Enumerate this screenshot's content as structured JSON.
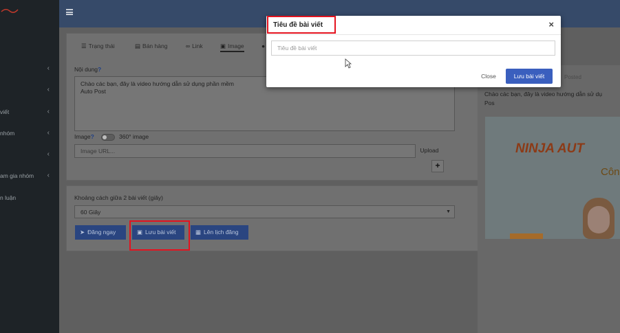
{
  "sidebar": {
    "items": [
      {
        "label": "",
        "icon": "chevron-left-icon"
      },
      {
        "label": "",
        "icon": "chevron-left-icon"
      },
      {
        "label": "viết",
        "icon": "chevron-left-icon"
      },
      {
        "label": "nhóm",
        "icon": "chevron-left-icon"
      },
      {
        "label": "",
        "icon": "chevron-left-icon"
      },
      {
        "label": "am gia nhóm",
        "icon": "chevron-left-icon"
      },
      {
        "label": "n luận",
        "icon": ""
      }
    ]
  },
  "editor": {
    "tabs": [
      {
        "label": "Trạng thái",
        "icon": "list-icon"
      },
      {
        "label": "Bán hàng",
        "icon": "cart-icon"
      },
      {
        "label": "Link",
        "icon": "link-icon"
      },
      {
        "label": "Image",
        "icon": "image-icon",
        "active": true
      }
    ],
    "content_label": "Nội dung",
    "content_text": "Chào các bạn, đây là video hướng dẫn sử dụng phần mềm",
    "content_text_2": "Auto Post",
    "image_label": "Image",
    "image_360_label": "360° image",
    "image_url_placeholder": "Image URL...",
    "upload_label": "Upload",
    "plus_label": "+"
  },
  "schedule": {
    "interval_label": "Khoảng cách giữa 2 bài viết (giây)",
    "interval_value": "60 Giây",
    "post_now": "Đăng ngay",
    "save_post": "Lưu bài viết",
    "schedule_post": "Lên lịch đăng"
  },
  "preview": {
    "meta": "Posted",
    "text_line1": "Chào các bạn, đây là video hướng dẫn sử dụ",
    "text_line2": "Pos",
    "banner_title": "NINJA AUT",
    "banner_sub": "Côn"
  },
  "modal": {
    "title": "Tiêu đề bài viết",
    "close_symbol": "×",
    "input_placeholder": "Tiêu đề bài viết",
    "close_label": "Close",
    "save_label": "Lưu bài viết"
  },
  "colors": {
    "highlight": "#e4121e",
    "primary_button": "#3a5fbe",
    "topbar": "#364a69",
    "sidebar": "#1e2327"
  }
}
